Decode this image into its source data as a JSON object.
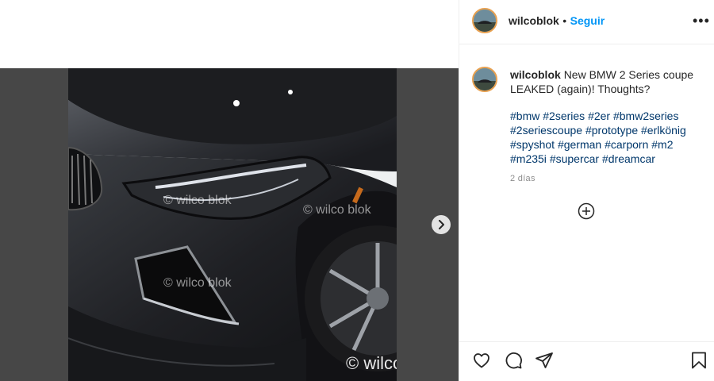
{
  "post": {
    "username": "wilcoblok",
    "dot": "•",
    "follow_label": "Seguir",
    "more_label": "•••",
    "caption_text": "New BMW 2 Series coupe LEAKED (again)! Thoughts?",
    "hashtags": [
      "#bmw",
      "#2series",
      "#2er",
      "#bmw2series",
      "#2seriescoupe",
      "#prototype",
      "#erlkönig",
      "#spyshot",
      "#german",
      "#carporn",
      "#m2",
      "#m235i",
      "#supercar",
      "#dreamcar"
    ],
    "time": "2 días"
  },
  "media": {
    "watermarks": [
      "© wilco blok",
      "© wilco blok",
      "© wilco blok",
      "© wilco blok"
    ]
  },
  "icons": {
    "next": "chevron-right-icon",
    "more": "more-options-icon",
    "add_comment": "add-comment-icon",
    "like": "heart-icon",
    "comment": "comment-icon",
    "share": "share-icon",
    "save": "bookmark-icon"
  },
  "colors": {
    "follow": "#0095f6",
    "hashtag": "#00376b",
    "avatar_ring": "#e8a04f"
  }
}
